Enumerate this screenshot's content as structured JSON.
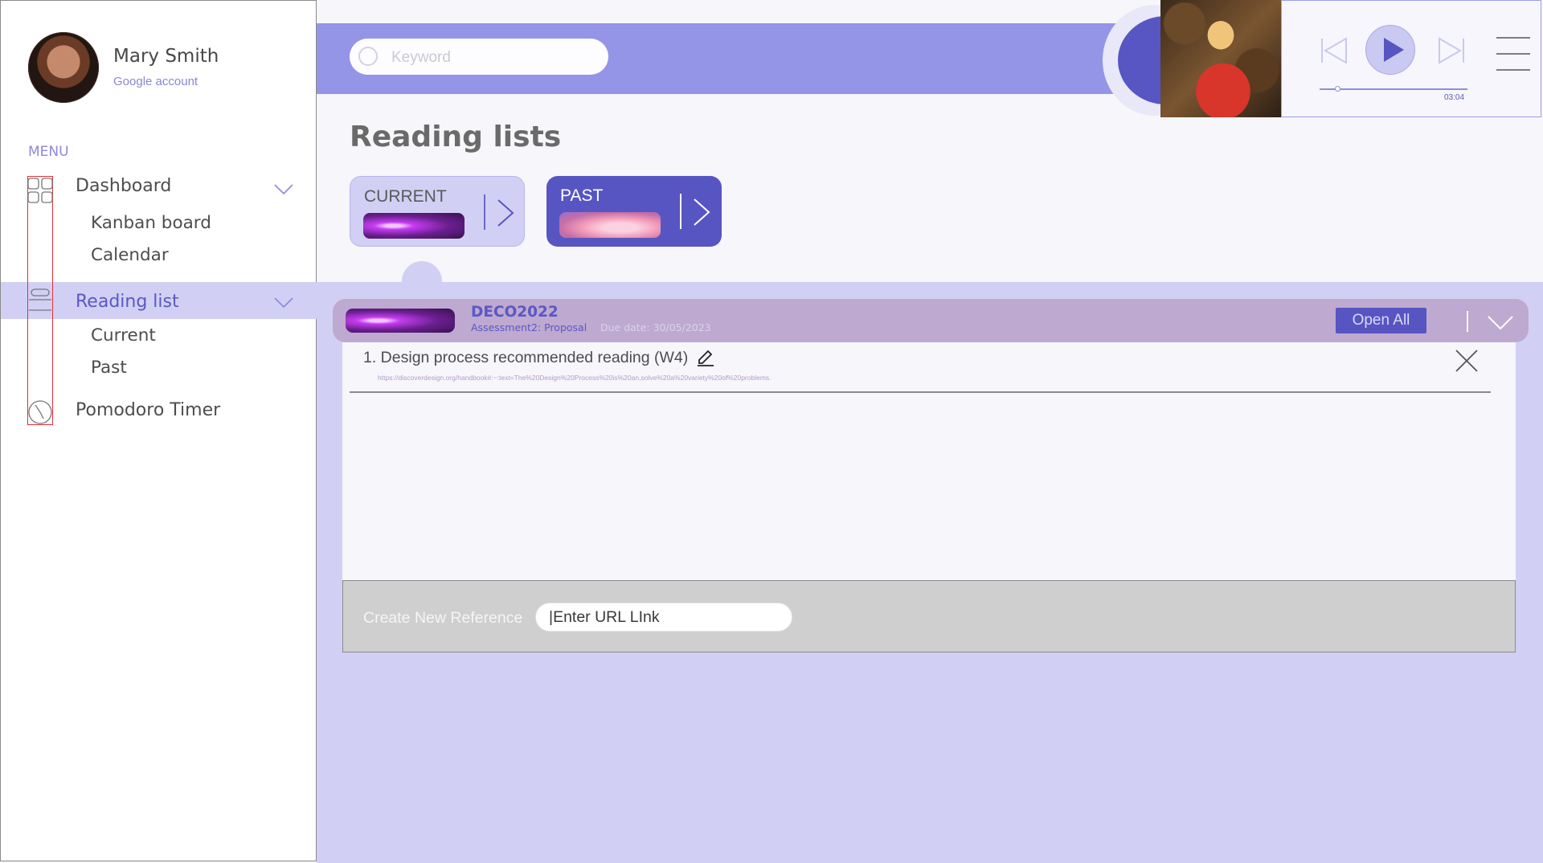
{
  "user": {
    "name": "Mary Smith",
    "account": "Google account"
  },
  "sidebar": {
    "menu_label": "MENU",
    "items": [
      {
        "label": "Dashboard",
        "icon": "dashboard-grid-icon",
        "expanded": true,
        "children": [
          "Kanban board",
          "Calendar"
        ]
      },
      {
        "label": "Reading list",
        "icon": "book-icon",
        "expanded": true,
        "active": true,
        "children": [
          "Current",
          "Past"
        ]
      },
      {
        "label": "Pomodoro Timer",
        "icon": "clock-icon"
      }
    ]
  },
  "search": {
    "placeholder": "Keyword"
  },
  "player": {
    "time": "03:04",
    "progress": 0.12
  },
  "main": {
    "title": "Reading lists",
    "cards": [
      {
        "label": "CURRENT"
      },
      {
        "label": "PAST"
      }
    ]
  },
  "course": {
    "code": "DECO2022",
    "assessment": "Assessment2: Proposal",
    "due": "Due date: 30/05/2023",
    "open_all_label": "Open All",
    "references": [
      {
        "title": "1. Design process recommended reading (W4)",
        "url": "https://discoverdesign.org/handbook#:~:text=The%20Design%20Process%20is%20an,solve%20a%20variety%20of%20problems."
      }
    ]
  },
  "footer": {
    "create_label": "Create New Reference",
    "url_placeholder": "|Enter URL LInk"
  },
  "colors": {
    "accent": "#5755c2",
    "accent_light": "#d1d0f4",
    "topbar": "#9495e6",
    "course_header": "#bea9d0"
  }
}
